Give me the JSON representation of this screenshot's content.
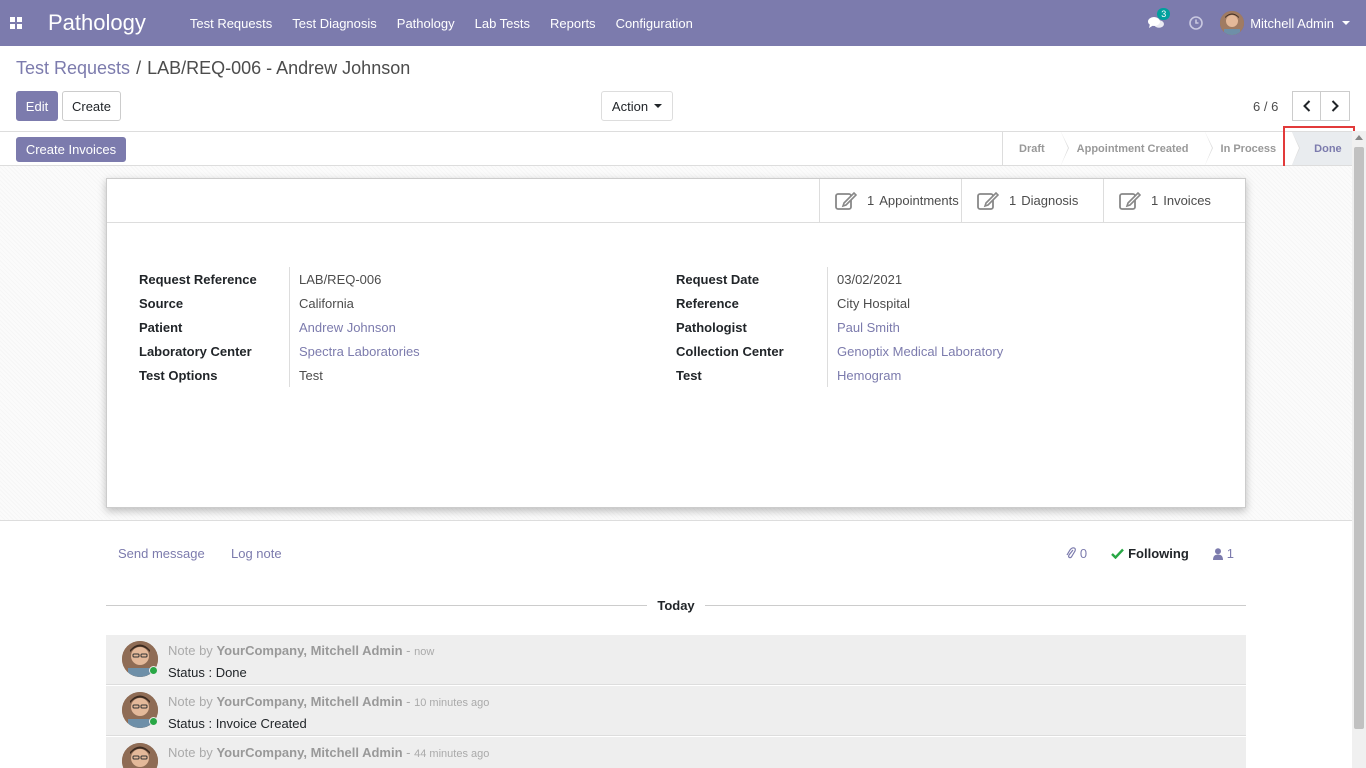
{
  "navbar": {
    "app_title": "Pathology",
    "menu": [
      "Test Requests",
      "Test Diagnosis",
      "Pathology",
      "Lab Tests",
      "Reports",
      "Configuration"
    ],
    "chat_count": "3",
    "user_name": "Mitchell Admin",
    "color": "#7c7bad"
  },
  "breadcrumb": {
    "parent": "Test Requests",
    "separator": "/",
    "current": "LAB/REQ-006 - Andrew Johnson"
  },
  "toolbar": {
    "edit_label": "Edit",
    "create_label": "Create",
    "action_label": "Action",
    "pager": "6 / 6"
  },
  "statusbar": {
    "create_invoices_label": "Create Invoices",
    "stages": [
      "Draft",
      "Appointment Created",
      "In Process",
      "Done"
    ],
    "active_stage": "Done"
  },
  "smart_buttons": [
    {
      "count": "1",
      "label": "Appointments"
    },
    {
      "count": "1",
      "label": "Diagnosis"
    },
    {
      "count": "1",
      "label": "Invoices"
    }
  ],
  "fields_left": [
    {
      "label": "Request Reference",
      "value": "LAB/REQ-006"
    },
    {
      "label": "Source",
      "value": "California"
    },
    {
      "label": "Patient",
      "value": "Andrew Johnson"
    },
    {
      "label": "Laboratory Center",
      "value": "Spectra Laboratories"
    },
    {
      "label": "Test Options",
      "value": "Test"
    }
  ],
  "fields_right": [
    {
      "label": "Request Date",
      "value": "03/02/2021"
    },
    {
      "label": "Reference",
      "value": "City Hospital"
    },
    {
      "label": "Pathologist",
      "value": "Paul Smith"
    },
    {
      "label": "Collection Center",
      "value": "Genoptix Medical Laboratory"
    },
    {
      "label": "Test",
      "value": "Hemogram"
    }
  ],
  "chatter": {
    "send_message": "Send message",
    "log_note": "Log note",
    "attachments_count": "0",
    "following_label": "Following",
    "followers_count": "1",
    "today_label": "Today",
    "messages": [
      {
        "prefix": "Note by",
        "author": "YourCompany, Mitchell Admin",
        "dash": "-",
        "time": "now",
        "body": "Status : Done"
      },
      {
        "prefix": "Note by",
        "author": "YourCompany, Mitchell Admin",
        "dash": "-",
        "time": "10 minutes ago",
        "body": "Status : Invoice Created"
      },
      {
        "prefix": "Note by",
        "author": "YourCompany, Mitchell Admin",
        "dash": "-",
        "time": "44 minutes ago",
        "body": ""
      }
    ]
  }
}
